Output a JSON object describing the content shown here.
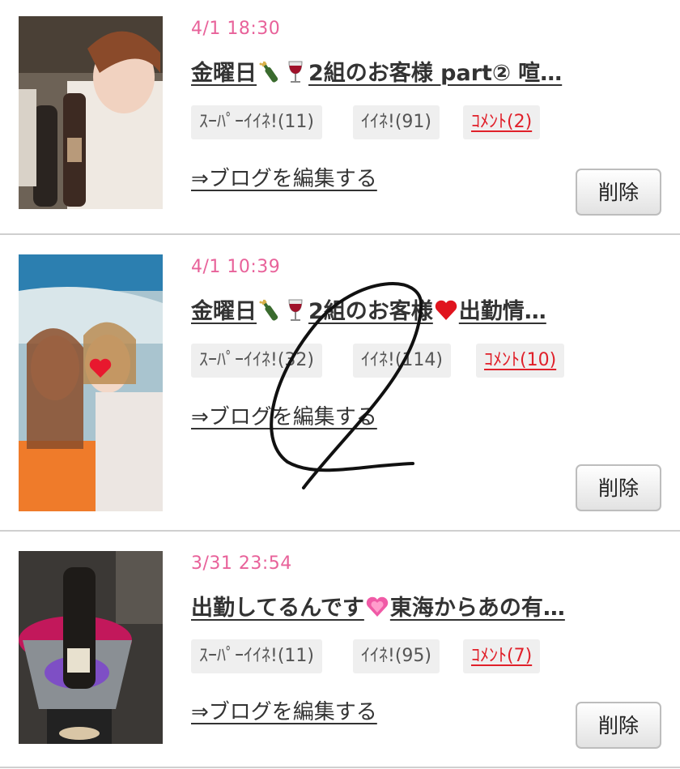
{
  "entries": [
    {
      "date": "4/1 18:30",
      "title_a": "金曜日",
      "title_b": "2組のお客様 part② 喧…",
      "super_like": "ｽｰﾊﾟｰｲｲﾈ!(11)",
      "like": "ｲｲﾈ!(91)",
      "comment": "ｺﾒﾝﾄ(2)",
      "edit_link": "⇒ブログを編集する",
      "delete_label": "削除"
    },
    {
      "date": "4/1 10:39",
      "title_a": "金曜日",
      "title_b": "2組のお客様",
      "title_c": "出勤情…",
      "super_like": "ｽｰﾊﾟｰｲｲﾈ!(32)",
      "like": "ｲｲﾈ!(114)",
      "comment": "ｺﾒﾝﾄ(10)",
      "edit_link": "⇒ブログを編集する",
      "delete_label": "削除"
    },
    {
      "date": "3/31 23:54",
      "title_a": "出勤してるんです",
      "title_b": "東海からあの有…",
      "super_like": "ｽｰﾊﾟｰｲｲﾈ!(11)",
      "like": "ｲｲﾈ!(95)",
      "comment": "ｺﾒﾝﾄ(7)",
      "edit_link": "⇒ブログを編集する",
      "delete_label": "削除"
    }
  ],
  "colors": {
    "date": "#e8629a",
    "comment": "#e0202a",
    "badge_bg": "#efefef",
    "divider": "#cfcfcf"
  },
  "icons": [
    "champagne-icon",
    "wine-glass-icon",
    "red-heart-icon",
    "pink-heart-icon"
  ]
}
